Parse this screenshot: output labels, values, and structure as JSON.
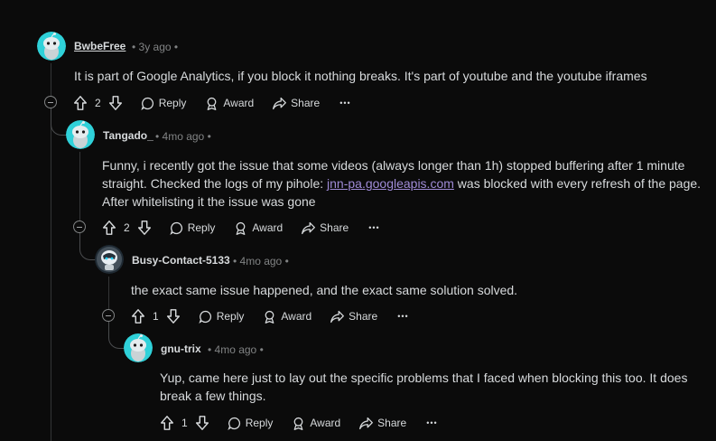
{
  "comments": [
    {
      "username": "BwbeFree",
      "meta": "• 3y ago •",
      "body": "It is part of Google Analytics, if you block it nothing breaks. It's part of youtube and the youtube iframes",
      "votes": "2",
      "reply_label": "Reply",
      "award_label": "Award",
      "share_label": "Share",
      "more_label": "•••"
    },
    {
      "username": "Tangado_",
      "meta": "• 4mo ago •",
      "body_line1": "Funny, i recently got the issue that some videos (always longer than 1h) stopped buffering after 1 minute",
      "body_pre": "straight. Checked the logs of my pihole: ",
      "body_link": "jnn-pa.googleapis.com",
      "body_post": " was blocked with every refresh of the page.",
      "body_line3": "After whitelisting it the issue was gone",
      "votes": "2",
      "reply_label": "Reply",
      "award_label": "Award",
      "share_label": "Share",
      "more_label": "•••"
    },
    {
      "username": "Busy-Contact-5133",
      "meta": "• 4mo ago •",
      "body": "the exact same issue happened, and the exact same solution solved.",
      "votes": "1",
      "reply_label": "Reply",
      "award_label": "Award",
      "share_label": "Share",
      "more_label": "•••"
    },
    {
      "username": "gnu-trix",
      "meta": "• 4mo ago •",
      "body_line1": "Yup, came here just to lay out the specific problems that I faced when blocking this too. It does",
      "body_line2": "break a few things.",
      "votes": "1",
      "reply_label": "Reply",
      "award_label": "Award",
      "share_label": "Share",
      "more_label": "•••"
    }
  ],
  "colors": {
    "background": "#0b0b0b",
    "text": "#d7dadc",
    "meta": "#818384",
    "link": "#9f8bd6",
    "avatar": "#2fd1d9"
  }
}
